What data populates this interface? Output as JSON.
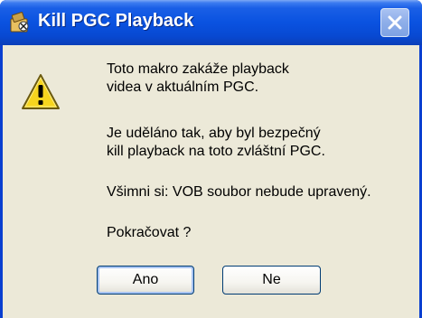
{
  "window": {
    "title": "Kill PGC Playback",
    "app_icon": "pgc-tool-icon",
    "close_icon": "close-icon"
  },
  "message": {
    "icon": "warning-icon",
    "line1": "Toto makro zakáže playback",
    "line2": "videa v aktuálním PGC.",
    "line3": "Je uděláno tak, aby byl bezpečný",
    "line4": "kill playback na toto zvláštní PGC.",
    "line5": "Všimni si: VOB soubor nebude upravený.",
    "line6": "Pokračovat ?"
  },
  "buttons": {
    "yes_label": "Ano",
    "no_label": "Ne"
  },
  "colors": {
    "title_bar": "#0a52e0",
    "client_bg": "#ece9d8",
    "warning": "#f7d51e"
  }
}
